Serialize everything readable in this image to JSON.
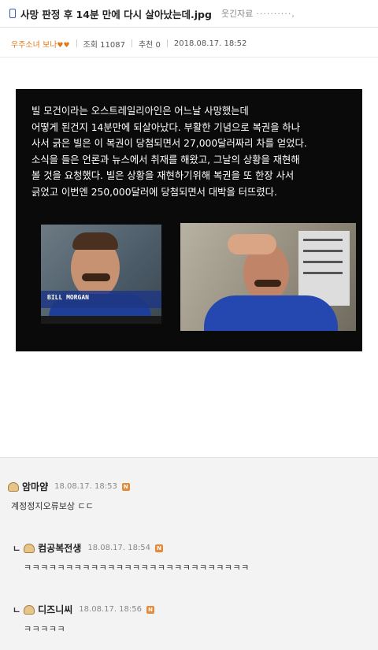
{
  "header": {
    "title": "사망 판정 후 14분 만에 다시 살아났는데.jpg",
    "category": "웃긴자료",
    "category_dots": "··········,"
  },
  "meta": {
    "author": "우주소녀 보나",
    "hearts": "♥♥",
    "views_label": "조회",
    "views": "11087",
    "likes_label": "추천",
    "likes": "0",
    "datetime": "2018.08.17. 18:52"
  },
  "content": {
    "story": "빌 모건이라는 오스트레일리아인은 어느날 사망했는데\n어떻게 된건지 14분만에 되살아났다. 부활한 기념으로 복권을 하나\n사서 긁은 빌은 이 복권이 당첨되면서 27,000달러짜리 차를 얻었다.\n소식을 들은 언론과 뉴스에서 취재를 해왔고, 그날의 상황을 재현해\n볼 것을 요청했다. 빌은 상황을 재현하기위해 복권을 또 한장 사서\n긁었고 이번엔 250,000달러에 당첨되면서 대박을 터뜨렸다.",
    "caption": "BILL MORGAN"
  },
  "comments": [
    {
      "nick": "암마얌",
      "time": "18.08.17. 18:53",
      "body": "계정정지오류보상 ㄷㄷ",
      "badge": "N",
      "reply": false
    },
    {
      "nick": "컴공복전생",
      "time": "18.08.17. 18:54",
      "body": "ㅋㅋㅋㅋㅋㅋㅋㅋㅋㅋㅋㅋㅋㅋㅋㅋㅋㅋㅋㅋㅋㅋㅋㅋㅋㅋㅋ",
      "badge": "N",
      "reply": true,
      "reply_mark": "ㄴ"
    },
    {
      "nick": "디즈니씨",
      "time": "18.08.17. 18:56",
      "body": "ㅋㅋㅋㅋㅋ",
      "badge": "N",
      "reply": true,
      "reply_mark": "ㄴ"
    }
  ],
  "colors": {
    "author": "#e07a1e",
    "badge": "#e58a38",
    "image_bg": "#0a0a0a"
  }
}
